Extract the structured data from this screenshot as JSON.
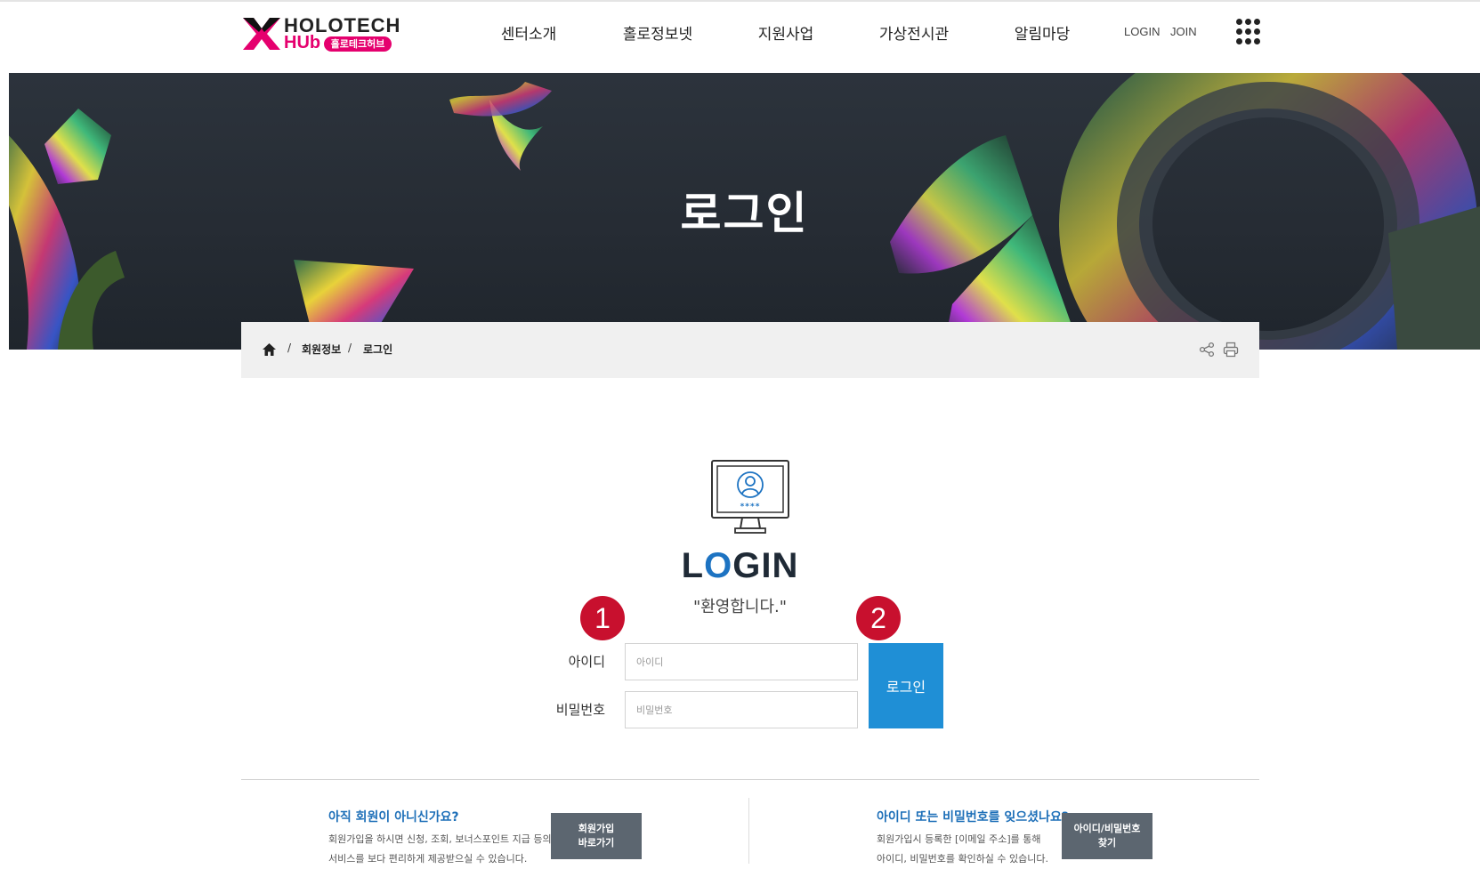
{
  "brand": {
    "logo_top": "HOLOTECH",
    "logo_hub": "HUb",
    "logo_korean": "홀로테크허브",
    "accent_color": "#e5006e"
  },
  "nav": {
    "items": [
      "센터소개",
      "홀로정보넷",
      "지원사업",
      "가상전시관",
      "알림마당"
    ],
    "login": "LOGIN",
    "join": "JOIN",
    "menu_icon": "grid-dots-icon"
  },
  "hero": {
    "title": "로그인"
  },
  "breadcrumb": {
    "home_icon": "home-icon",
    "separator": "/",
    "items": [
      "회원정보",
      "로그인"
    ],
    "share_icon": "share-icon",
    "print_icon": "print-icon"
  },
  "login": {
    "icon": "monitor-user-icon",
    "title_prefix": "L",
    "title_o": "O",
    "title_suffix": "GIN",
    "welcome": "\"환영합니다.\"",
    "id_label": "아이디",
    "id_placeholder": "아이디",
    "id_value": "",
    "pw_label": "비밀번호",
    "pw_placeholder": "비밀번호",
    "pw_value": "",
    "button_label": "로그인",
    "button_color": "#1f8fd6",
    "badges": [
      "1",
      "2"
    ],
    "badge_color": "#c8102e"
  },
  "info": {
    "signup": {
      "title": "아직 회원이 아니신가요?",
      "text_line1": "회원가입을 하시면 신청, 조회, 보너스포인트 지급 등의",
      "text_line2": "서비스를 보다 편리하게 제공받으실 수 있습니다.",
      "button": "회원가입\n바로가기"
    },
    "find": {
      "title": "아이디 또는 비밀번호를 잊으셨나요?",
      "text_line1": "회원가입시 등록한 [이메일 주소]를 통해",
      "text_line2": "아이디, 비밀번호를 확인하실 수 있습니다.",
      "button": "아이디/비밀번호\n찾기"
    }
  }
}
